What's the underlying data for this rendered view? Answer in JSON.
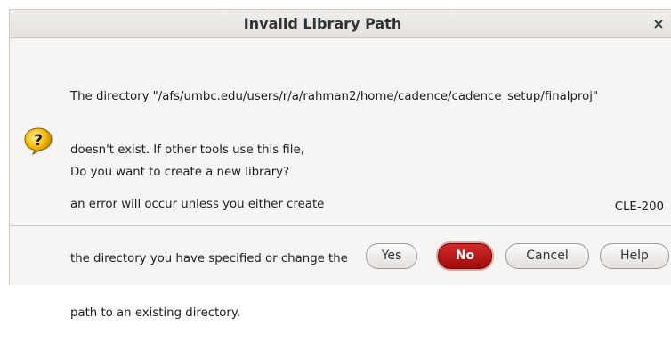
{
  "dialog": {
    "title": "Invalid Library Path",
    "close_glyph": "×",
    "message_lines": [
      "The directory \"/afs/umbc.edu/users/r/a/rahman2/home/cadence/cadence_setup/finalproj\"",
      "doesn't exist. If other tools use this file,",
      "an error will occur unless you either create",
      "the directory you have specified or change the",
      "path to an existing directory."
    ],
    "prompt": "Do you want to create a new library?",
    "code": "CLE-200",
    "icon": "question-icon"
  },
  "buttons": {
    "yes": "Yes",
    "no": "No",
    "cancel": "Cancel",
    "help": "Help"
  },
  "colors": {
    "default_button": "#c00f0f",
    "icon_fill": "#f4b800"
  }
}
